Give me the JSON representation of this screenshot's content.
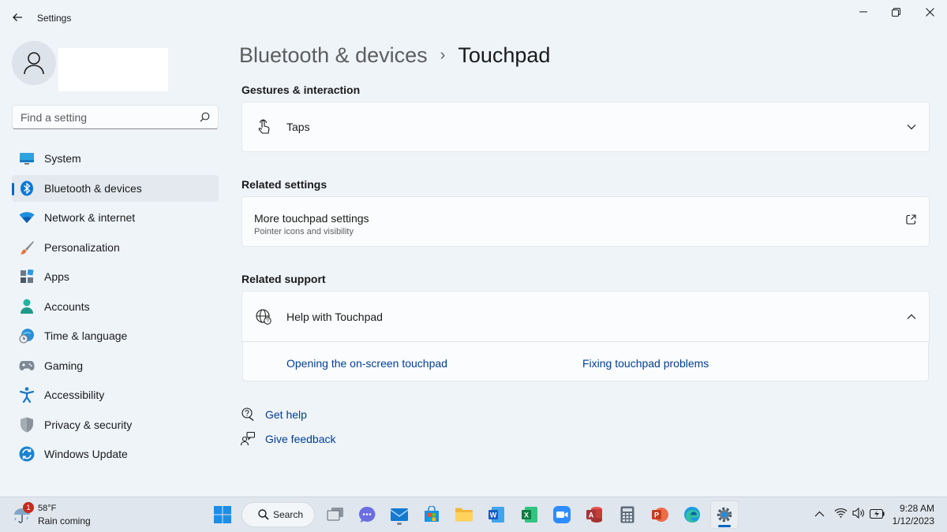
{
  "window": {
    "title": "Settings"
  },
  "search": {
    "placeholder": "Find a setting"
  },
  "sidebar": {
    "items": [
      {
        "label": "System",
        "icon": "system-icon"
      },
      {
        "label": "Bluetooth & devices",
        "icon": "bluetooth-icon",
        "active": true
      },
      {
        "label": "Network & internet",
        "icon": "wifi-icon"
      },
      {
        "label": "Personalization",
        "icon": "brush-icon"
      },
      {
        "label": "Apps",
        "icon": "apps-icon"
      },
      {
        "label": "Accounts",
        "icon": "accounts-icon"
      },
      {
        "label": "Time & language",
        "icon": "globe-clock-icon"
      },
      {
        "label": "Gaming",
        "icon": "gamepad-icon"
      },
      {
        "label": "Accessibility",
        "icon": "accessibility-icon"
      },
      {
        "label": "Privacy & security",
        "icon": "shield-icon"
      },
      {
        "label": "Windows Update",
        "icon": "update-icon"
      }
    ]
  },
  "breadcrumb": {
    "parent": "Bluetooth & devices",
    "separator": "›",
    "current": "Touchpad"
  },
  "sections": {
    "gestures": {
      "heading": "Gestures & interaction",
      "taps_label": "Taps"
    },
    "related_settings": {
      "heading": "Related settings",
      "more_label": "More touchpad settings",
      "more_sub": "Pointer icons and visibility"
    },
    "related_support": {
      "heading": "Related support",
      "help_label": "Help with Touchpad",
      "links": [
        "Opening the on-screen touchpad",
        "Fixing touchpad problems"
      ]
    }
  },
  "footer": {
    "get_help": "Get help",
    "give_feedback": "Give feedback"
  },
  "taskbar": {
    "weather_temp": "58°F",
    "weather_cond": "Rain coming",
    "weather_badge": "1",
    "search_label": "Search",
    "time": "9:28 AM",
    "date": "1/12/2023"
  },
  "colors": {
    "accent": "#0067c0",
    "link": "#003e92",
    "background": "#eff4f9",
    "card": "#fbfcfd"
  }
}
